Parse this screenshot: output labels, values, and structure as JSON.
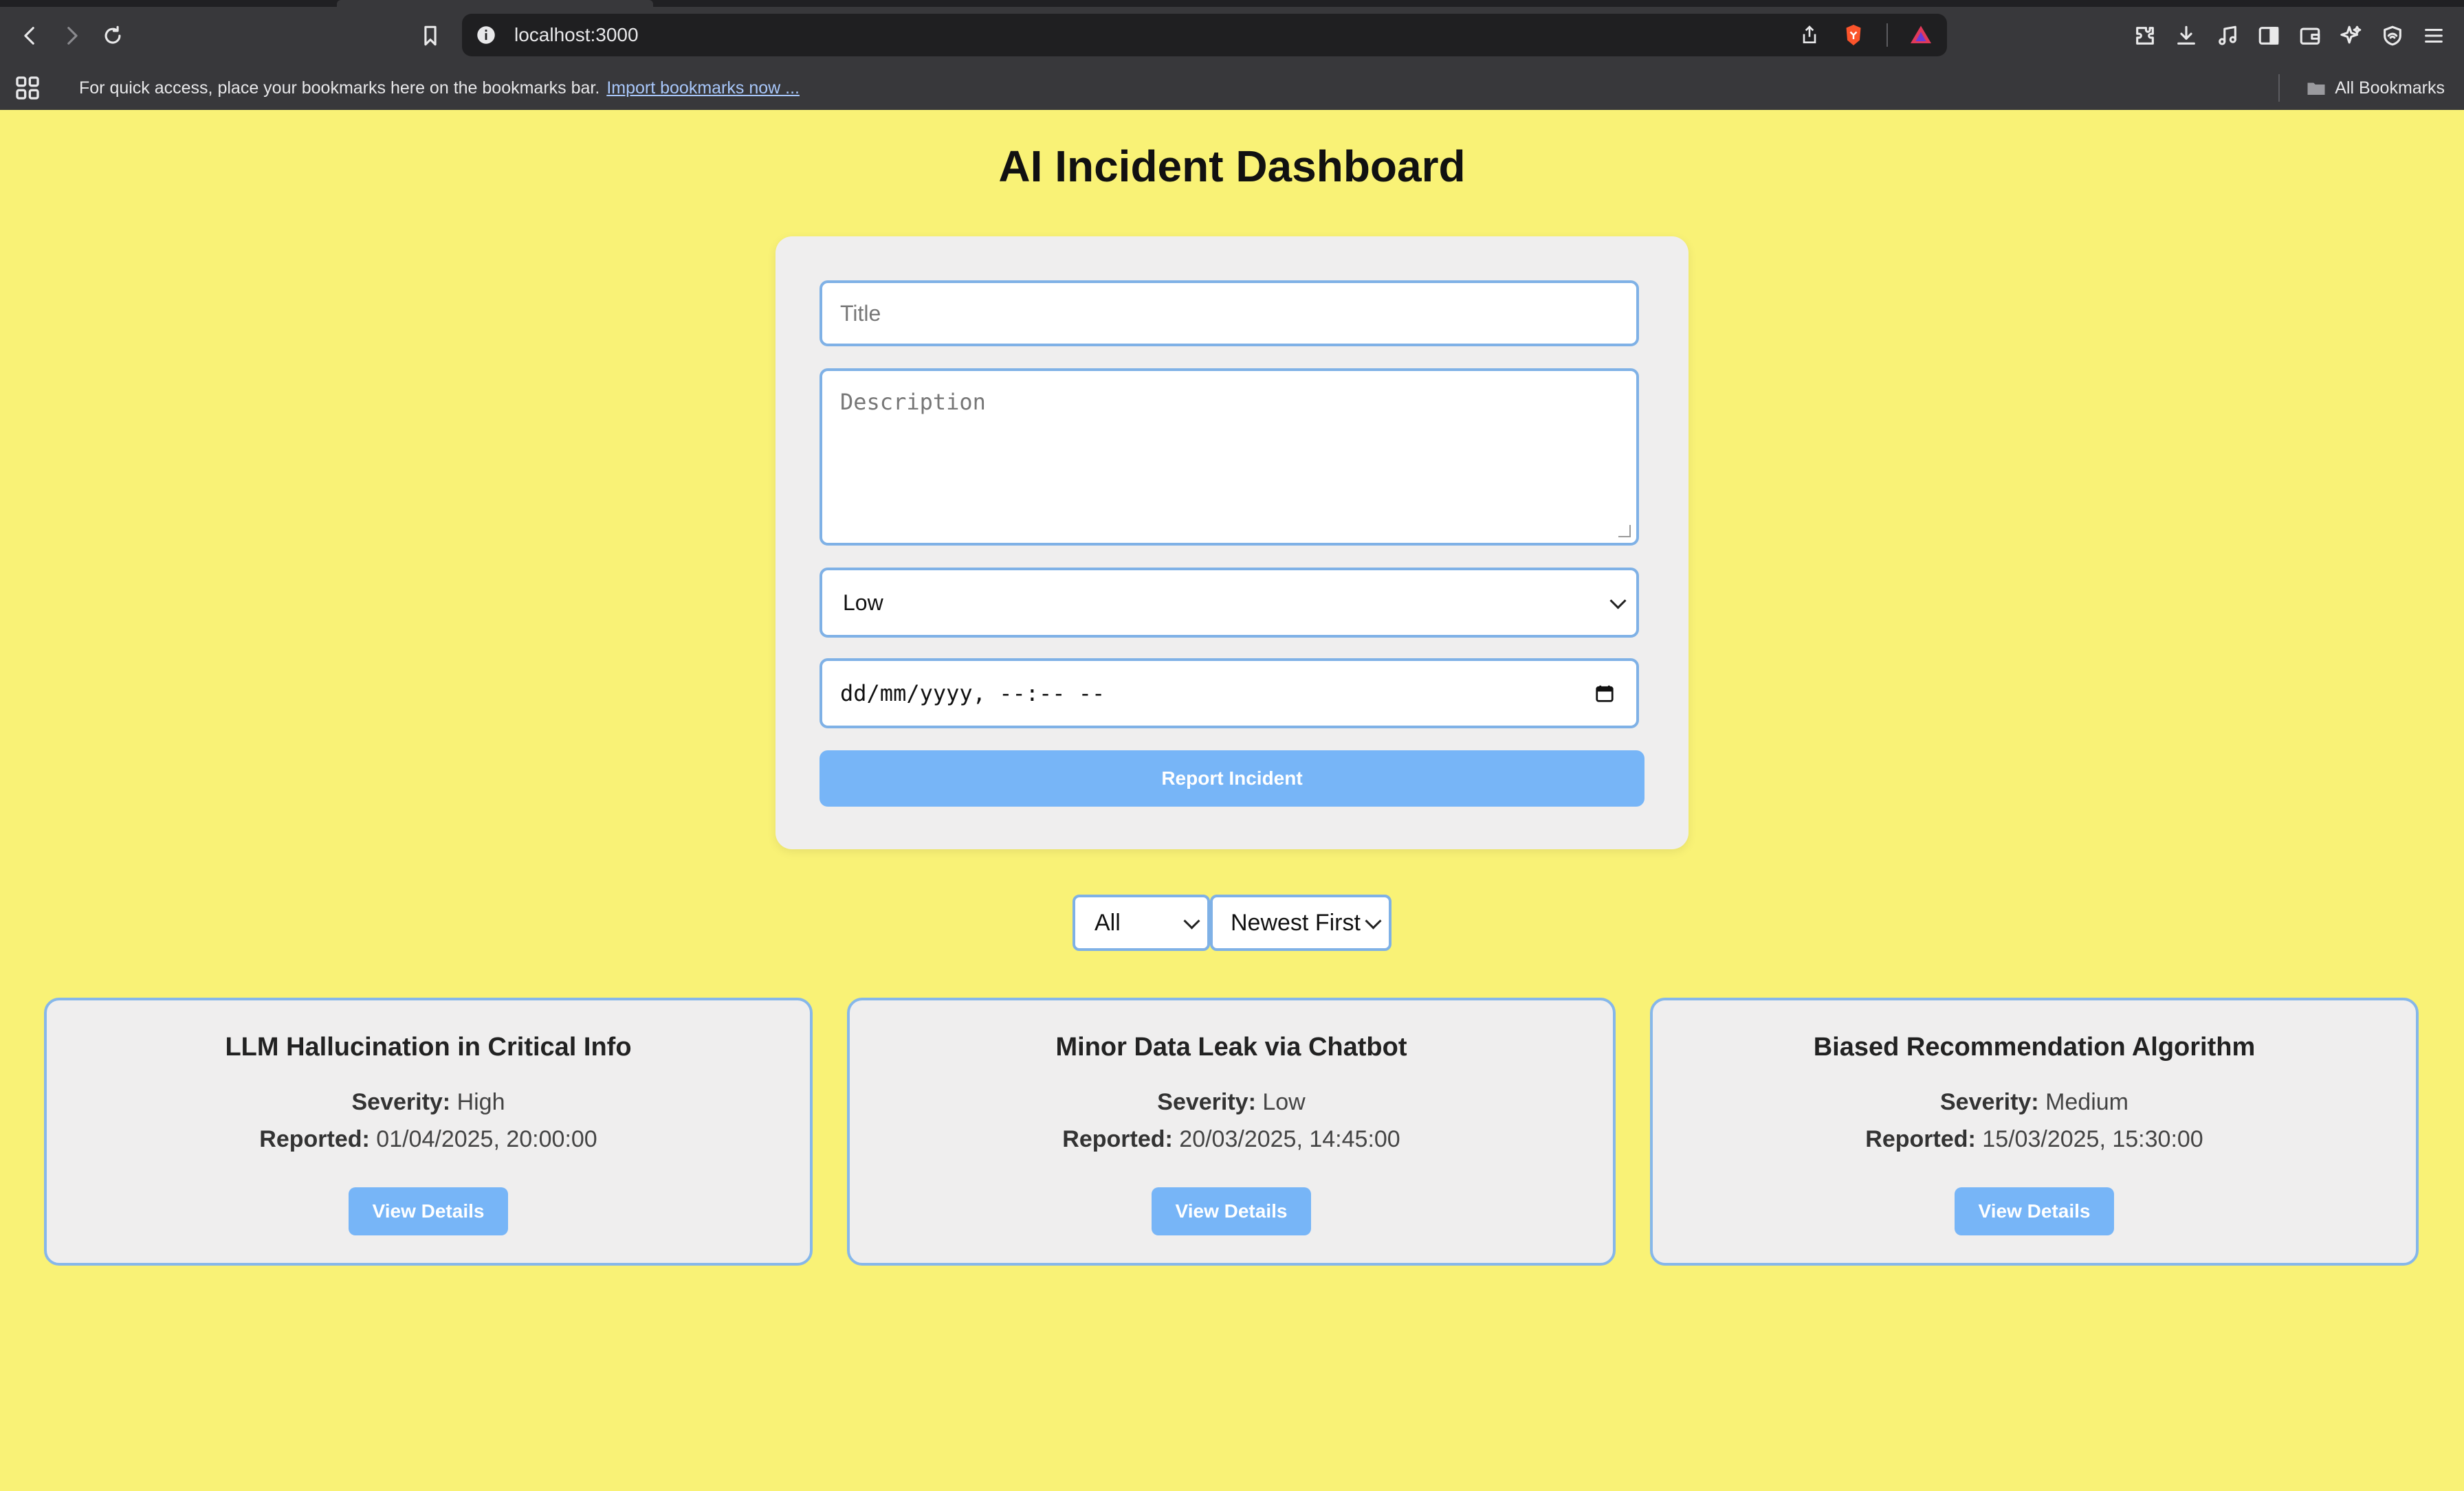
{
  "browser": {
    "url": "localhost:3000",
    "bookmarks_message": "For quick access, place your bookmarks here on the bookmarks bar.",
    "import_link": "Import bookmarks now ...",
    "all_bookmarks": "All Bookmarks"
  },
  "page": {
    "title": "AI Incident Dashboard"
  },
  "form": {
    "title_placeholder": "Title",
    "description_placeholder": "Description",
    "severity_value": "Low",
    "datetime_placeholder": "dd/mm/yyyy, --:-- --",
    "submit_label": "Report Incident"
  },
  "filters": {
    "severity_value": "All",
    "sort_value": "Newest First"
  },
  "incidents": [
    {
      "title": "LLM Hallucination in Critical Info",
      "severity_label": "Severity:",
      "severity": "High",
      "reported_label": "Reported:",
      "reported": "01/04/2025, 20:00:00",
      "button": "View Details"
    },
    {
      "title": "Minor Data Leak via Chatbot",
      "severity_label": "Severity:",
      "severity": "Low",
      "reported_label": "Reported:",
      "reported": "20/03/2025, 14:45:00",
      "button": "View Details"
    },
    {
      "title": "Biased Recommendation Algorithm",
      "severity_label": "Severity:",
      "severity": "Medium",
      "reported_label": "Reported:",
      "reported": "15/03/2025, 15:30:00",
      "button": "View Details"
    }
  ],
  "colors": {
    "background": "#f9f276",
    "accent": "#77b5f7",
    "field_border": "#7fb1e6"
  }
}
